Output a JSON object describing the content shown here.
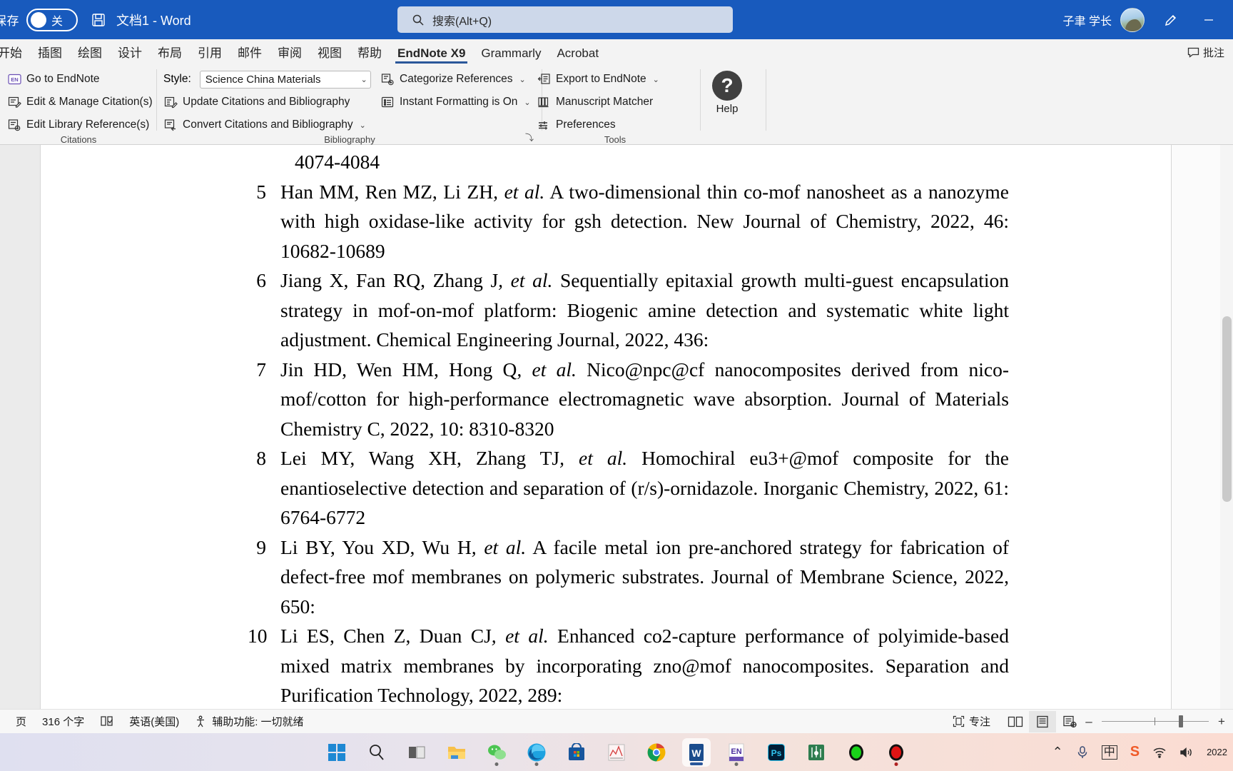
{
  "titlebar": {
    "autosave_label": "保存",
    "autosave_state": "关",
    "save_icon": "save-icon",
    "document_title": "文档1 - Word",
    "user_name": "子聿 学长",
    "minimize_label": "–"
  },
  "search": {
    "placeholder": "搜索(Alt+Q)",
    "icon": "search-icon"
  },
  "tabs": [
    {
      "label": "开始",
      "active": false
    },
    {
      "label": "插图",
      "active": false
    },
    {
      "label": "绘图",
      "active": false
    },
    {
      "label": "设计",
      "active": false
    },
    {
      "label": "布局",
      "active": false
    },
    {
      "label": "引用",
      "active": false
    },
    {
      "label": "邮件",
      "active": false
    },
    {
      "label": "审阅",
      "active": false
    },
    {
      "label": "视图",
      "active": false
    },
    {
      "label": "帮助",
      "active": false
    },
    {
      "label": "EndNote X9",
      "active": true
    },
    {
      "label": "Grammarly",
      "active": false
    },
    {
      "label": "Acrobat",
      "active": false
    }
  ],
  "comments_button": "批注",
  "ribbon": {
    "citations": {
      "group_label": "Citations",
      "items": [
        {
          "label": "Go to EndNote",
          "icon": "endnote-icon"
        },
        {
          "label": "Edit & Manage Citation(s)",
          "icon": "edit-citation-icon"
        },
        {
          "label": "Edit Library Reference(s)",
          "icon": "edit-library-icon"
        }
      ]
    },
    "bibliography": {
      "group_label": "Bibliography",
      "style_label": "Style:",
      "style_value": "Science China Materials",
      "items": [
        {
          "label": "Update Citations and Bibliography",
          "icon": "update-bibliography-icon"
        },
        {
          "label": "Convert Citations and Bibliography",
          "icon": "convert-bibliography-icon",
          "chevron": "⌄"
        }
      ],
      "items2": [
        {
          "label": "Categorize References",
          "icon": "categorize-references-icon",
          "chevron": "⌄"
        },
        {
          "label": "Instant Formatting is On",
          "icon": "instant-formatting-icon",
          "chevron": "⌄"
        }
      ],
      "dialog_launcher": "⤵"
    },
    "tools": {
      "group_label": "Tools",
      "items": [
        {
          "label": "Export to EndNote",
          "icon": "export-endnote-icon",
          "chevron": "⌄"
        },
        {
          "label": "Manuscript Matcher",
          "icon": "manuscript-matcher-icon"
        },
        {
          "label": "Preferences",
          "icon": "preferences-icon"
        }
      ]
    },
    "help": {
      "label": "Help",
      "glyph": "?"
    }
  },
  "document": {
    "top_fragment": "4074-4084",
    "references": [
      {
        "num": "5",
        "pre": "Han MM, Ren MZ, Li ZH",
        "etal": ", et al.",
        "post": " A two-dimensional thin co-mof nanosheet as a nanozyme with high oxidase-like activity for gsh detection. New Journal of Chemistry, 2022, 46: 10682-10689"
      },
      {
        "num": "6",
        "pre": "Jiang X, Fan RQ, Zhang J",
        "etal": ", et al.",
        "post": " Sequentially epitaxial growth multi-guest encapsulation strategy in mof-on-mof platform: Biogenic amine detection and systematic white light adjustment. Chemical Engineering Journal, 2022, 436:"
      },
      {
        "num": "7",
        "pre": "Jin HD, Wen HM, Hong Q",
        "etal": ", et al.",
        "post": " Nico@npc@cf nanocomposites derived from nico-mof/cotton for high-performance electromagnetic wave absorption. Journal of Materials Chemistry C, 2022, 10: 8310-8320"
      },
      {
        "num": "8",
        "pre": "Lei MY, Wang XH, Zhang TJ",
        "etal": ", et al.",
        "post": " Homochiral eu3+@mof composite for the enantioselective detection and separation of (r/s)-ornidazole. Inorganic Chemistry, 2022, 61: 6764-6772"
      },
      {
        "num": "9",
        "pre": "Li BY, You XD, Wu H",
        "etal": ", et al.",
        "post": " A facile metal ion pre-anchored strategy for fabrication of defect-free mof membranes on polymeric substrates. Journal of Membrane Science, 2022, 650:"
      },
      {
        "num": "10",
        "pre": "Li ES, Chen Z, Duan CJ",
        "etal": ", et al.",
        "post": " Enhanced co2-capture performance of polyimide-based mixed matrix membranes by incorporating zno@mof nanocomposites. Separation and Purification Technology, 2022, 289:"
      }
    ]
  },
  "statusbar": {
    "page_label": "页",
    "word_count": "316 个字",
    "proofing_icon": "proofing-icon",
    "language": "英语(美国)",
    "accessibility": "辅助功能: 一切就绪",
    "focus_label": "专注",
    "view_read_icon": "read-mode-icon",
    "view_print_icon": "print-layout-icon",
    "view_web_icon": "web-layout-icon",
    "zoom_out": "–",
    "zoom_in": "+"
  },
  "taskbar": {
    "icons": [
      {
        "name": "start-icon",
        "label": ""
      },
      {
        "name": "search-icon",
        "label": ""
      },
      {
        "name": "task-view-icon",
        "label": ""
      },
      {
        "name": "file-explorer-icon",
        "label": ""
      },
      {
        "name": "wechat-icon",
        "label": ""
      },
      {
        "name": "edge-icon",
        "label": ""
      },
      {
        "name": "microsoft-store-icon",
        "label": ""
      },
      {
        "name": "origin-app-icon",
        "label": ""
      },
      {
        "name": "chrome-icon",
        "label": ""
      },
      {
        "name": "word-icon",
        "label": "W"
      },
      {
        "name": "endnote-icon",
        "label": "EN"
      },
      {
        "name": "photoshop-icon",
        "label": "Ps"
      },
      {
        "name": "diagram-app-icon",
        "label": ""
      },
      {
        "name": "green-recorder-icon",
        "label": ""
      },
      {
        "name": "red-recorder-icon",
        "label": ""
      }
    ],
    "tray": {
      "chevron": "⌃",
      "mic_icon": "microphone-icon",
      "ime": "中",
      "sogou": "S",
      "network_icon": "wifi-icon",
      "volume_icon": "volume-icon",
      "clock": "2022"
    }
  },
  "colors": {
    "word_blue": "#185ABD",
    "ribbon_bg": "#f3f3f3",
    "accent_underline": "#2B579A"
  }
}
